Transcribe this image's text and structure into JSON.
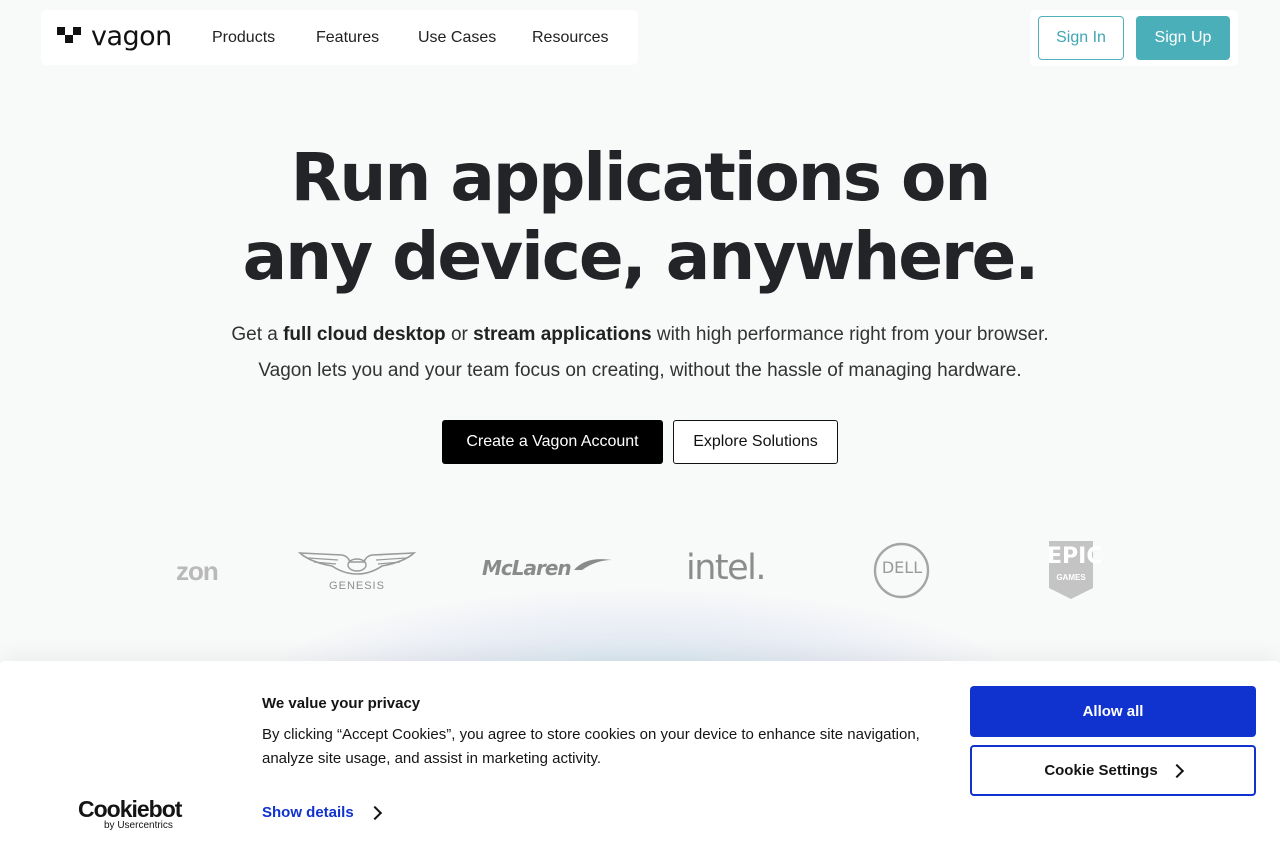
{
  "header": {
    "logo_text": "vagon",
    "nav": [
      {
        "label": "Products"
      },
      {
        "label": "Features"
      },
      {
        "label": "Use Cases"
      },
      {
        "label": "Resources"
      }
    ],
    "sign_in": "Sign In",
    "sign_up": "Sign Up"
  },
  "hero": {
    "title_line1": "Run applications on",
    "title_line2": "any device, anywhere.",
    "sub1_a": "Get a ",
    "sub1_b": "full cloud desktop",
    "sub1_c": " or ",
    "sub1_d": "stream applications",
    "sub1_e": " with high performance right from your browser.",
    "sub2": "Vagon lets you and your team focus on creating, without the hassle of managing hardware.",
    "primary_cta": "Create a Vagon Account",
    "secondary_cta": "Explore Solutions"
  },
  "brands": {
    "amazon": "zon",
    "genesis": "GENESIS",
    "mclaren": "McLaren",
    "intel": "intel.",
    "dell": "DELL",
    "epic": "EPIC",
    "epic_sub": "GAMES"
  },
  "cookie": {
    "title": "We value your privacy",
    "text": "By clicking “Accept Cookies”, you agree to store cookies on your device to enhance site navigation, analyze site usage, and assist in marketing activity.",
    "show_details": "Show details",
    "allow_all": "Allow all",
    "settings": "Cookie Settings",
    "logo_word": "Cookiebot",
    "logo_by": "by Usercentrics"
  },
  "colors": {
    "accent_teal": "#4aafb9",
    "cookie_blue": "#1032cf"
  }
}
